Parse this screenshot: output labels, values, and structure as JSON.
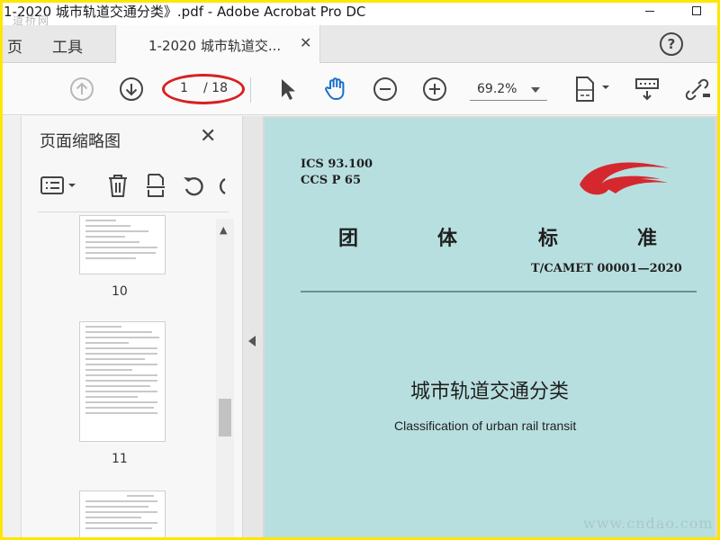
{
  "window": {
    "title": "1-2020 城市轨道交通分类》.pdf - Adobe Acrobat Pro DC",
    "brand_overlay": "道桥网"
  },
  "menu": {
    "page_label": "页",
    "tools_label": "工具"
  },
  "tab": {
    "label": "1-2020 城市轨道交..."
  },
  "toolbar": {
    "page_current": "1",
    "page_total": "/ 18",
    "zoom": "69.2%",
    "icons": [
      "arrow-up-circle",
      "arrow-down-circle",
      "pointer",
      "hand",
      "zoom-out",
      "zoom-in",
      "fit-page",
      "scroll-mode",
      "link"
    ]
  },
  "panel": {
    "title": "页面缩略图",
    "icons": [
      "options",
      "trash",
      "extract",
      "undo",
      "redo"
    ],
    "thumbnails": [
      {
        "number": "10"
      },
      {
        "number": "11"
      }
    ]
  },
  "document": {
    "ics": "ICS  93.100",
    "ccs": "CCS  P  65",
    "std_chars": [
      "团",
      "体",
      "标",
      "准"
    ],
    "std_code": "T/CAMET  00001—2020",
    "title_cn": "城市轨道交通分类",
    "title_en": "Classification of urban rail transit",
    "page_color": "#b8dfdf",
    "logo_color": "#d5282e"
  },
  "watermark": "www.cndao.com",
  "colors": {
    "highlight": "#d82020",
    "frame": "#ffe600"
  }
}
